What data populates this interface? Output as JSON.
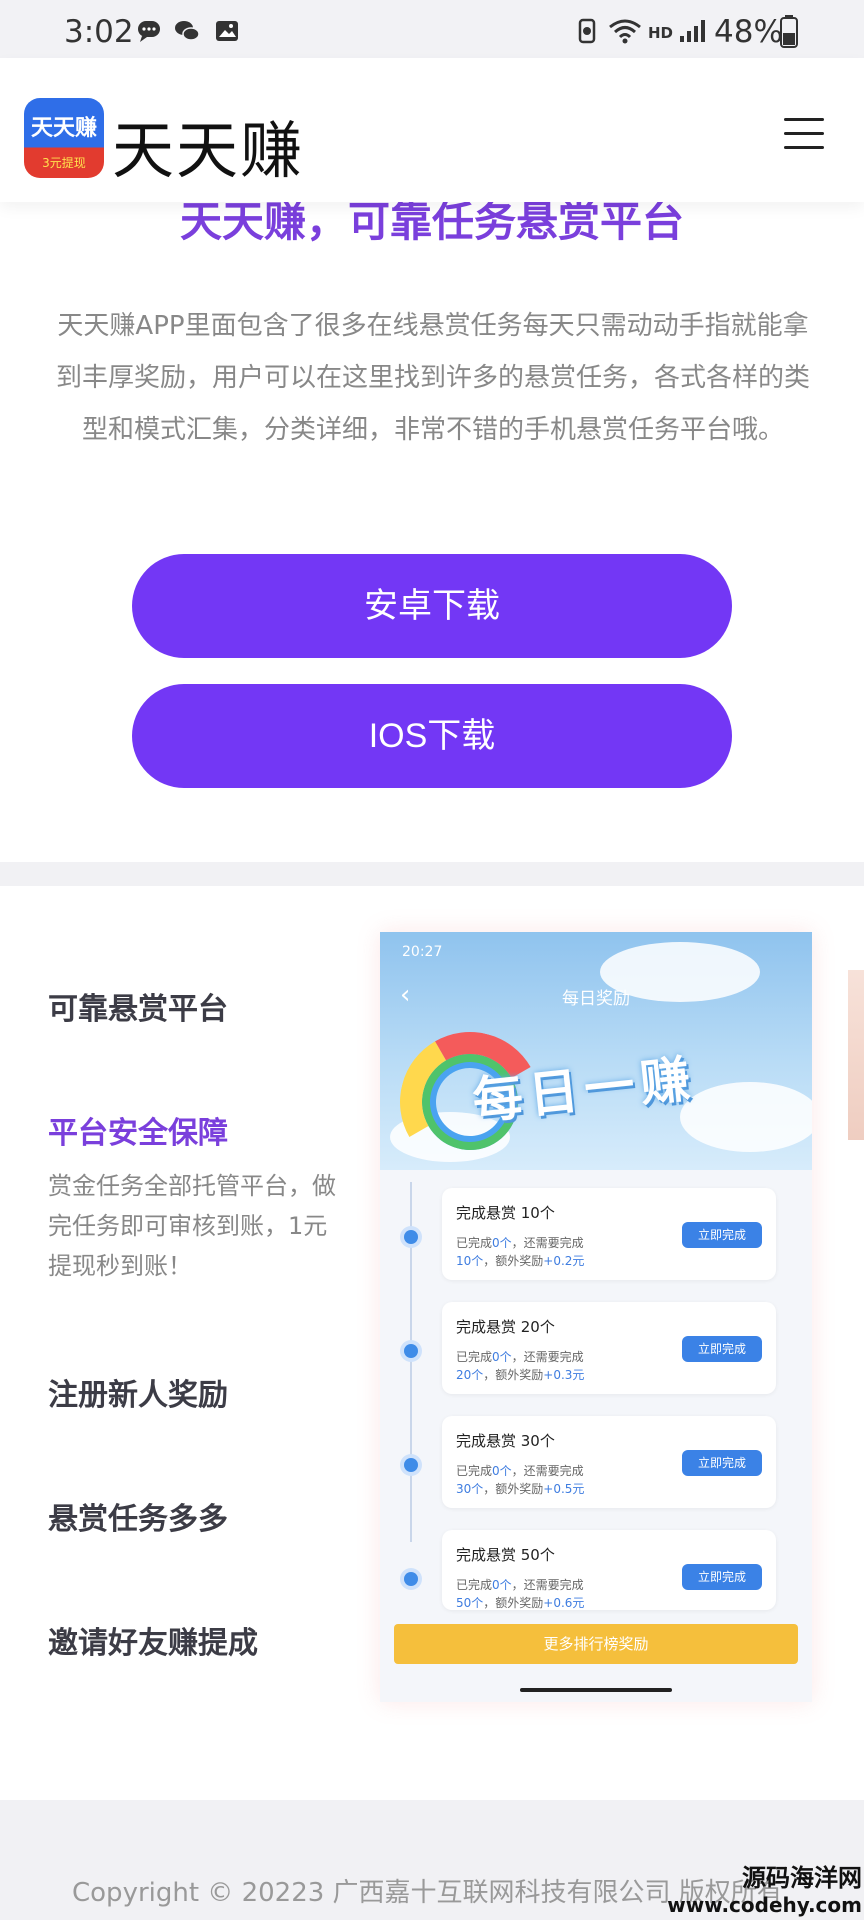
{
  "status_bar": {
    "time": "3:02",
    "network": "HD",
    "battery": "48%"
  },
  "header": {
    "logo_text": "天天赚",
    "logo_subtext": "3元提现",
    "brand": "天天赚"
  },
  "hero": {
    "title": "天天赚，可靠任务悬赏平台",
    "description": "天天赚APP里面包含了很多在线悬赏任务每天只需动动手指就能拿到丰厚奖励，用户可以在这里找到许多的悬赏任务，各式各样的类型和模式汇集，分类详细，非常不错的手机悬赏任务平台哦。",
    "android_button": "安卓下载",
    "ios_button": "IOS下载"
  },
  "features": [
    {
      "title": "可靠悬赏平台"
    },
    {
      "title": "平台安全保障",
      "description": "赏金任务全部托管平台，做完任务即可审核到账，1元提现秒到账！"
    },
    {
      "title": "注册新人奖励"
    },
    {
      "title": "悬赏任务多多"
    },
    {
      "title": "邀请好友赚提成"
    }
  ],
  "phone": {
    "time": "20:27",
    "title": "每日奖励",
    "banner": "每日一赚",
    "tasks": [
      {
        "title": "完成悬赏 10个",
        "line1a": "已完成",
        "done": "0个",
        "line1b": "，还需要完成",
        "need": "10个",
        "line2b": "，额外奖励",
        "bonus": "+0.2元",
        "button": "立即完成"
      },
      {
        "title": "完成悬赏 20个",
        "line1a": "已完成",
        "done": "0个",
        "line1b": "，还需要完成",
        "need": "20个",
        "line2b": "，额外奖励",
        "bonus": "+0.3元",
        "button": "立即完成"
      },
      {
        "title": "完成悬赏 30个",
        "line1a": "已完成",
        "done": "0个",
        "line1b": "，还需要完成",
        "need": "30个",
        "line2b": "，额外奖励",
        "bonus": "+0.5元",
        "button": "立即完成"
      },
      {
        "title": "完成悬赏 50个",
        "line1a": "已完成",
        "done": "0个",
        "line1b": "，还需要完成",
        "need": "50个",
        "line2b": "，额外奖励",
        "bonus": "+0.6元",
        "button": "立即完成"
      }
    ],
    "more_button": "更多排行榜奖励"
  },
  "footer": {
    "copyright": "Copyright © 20223 广西嘉十互联网科技有限公司 版权所有"
  },
  "watermark": {
    "line1": "源码海洋网",
    "line2": "www.codehy.com"
  }
}
